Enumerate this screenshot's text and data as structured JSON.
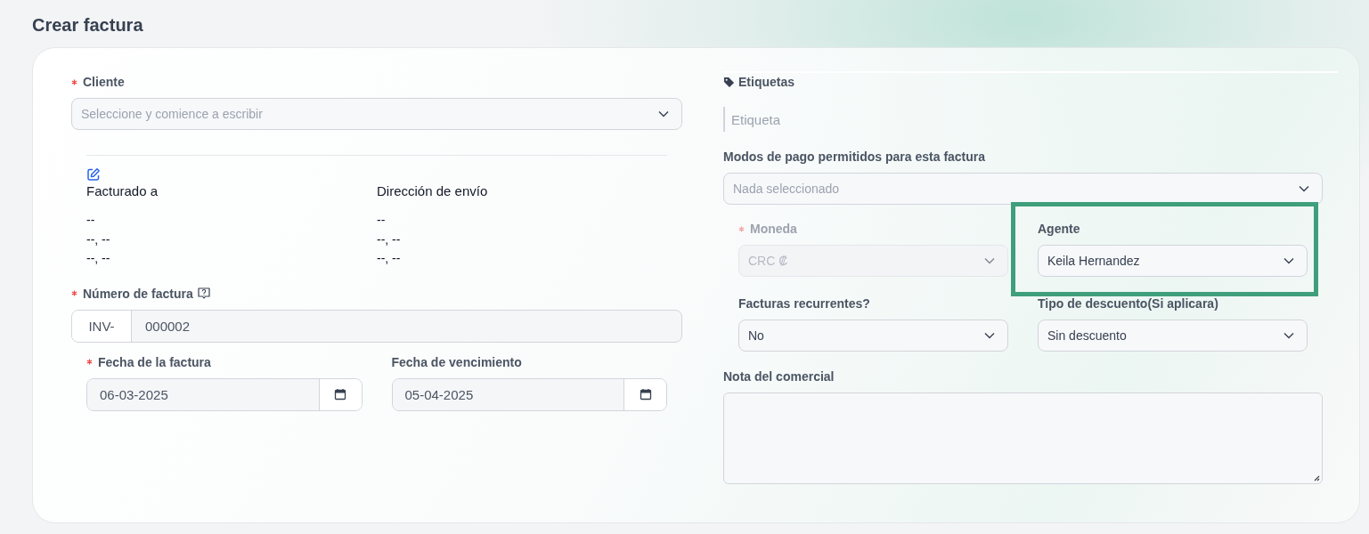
{
  "page": {
    "title": "Crear factura"
  },
  "client": {
    "label": "Cliente",
    "required": true,
    "placeholder": "Seleccione y comience a escribir"
  },
  "addresses": [
    {
      "heading": "Facturado a",
      "lines": [
        "--",
        "--, --",
        "--, --"
      ]
    },
    {
      "heading": "Dirección de envío",
      "lines": [
        "--",
        "--, --",
        "--, --"
      ]
    }
  ],
  "invoice_number": {
    "label": "Número de factura",
    "required": true,
    "prefix": "INV-",
    "value": "000002"
  },
  "dates": [
    {
      "label": "Fecha de la factura",
      "required": true,
      "value": "06-03-2025"
    },
    {
      "label": "Fecha de vencimiento",
      "required": false,
      "value": "05-04-2025"
    }
  ],
  "tags": {
    "label": "Etiquetas",
    "placeholder": "Etiqueta"
  },
  "payment_modes": {
    "label": "Modos de pago permitidos para esta factura",
    "placeholder": "Nada seleccionado"
  },
  "selects": [
    {
      "label": "Moneda",
      "required": true,
      "disabled": true,
      "value": "CRC ₡",
      "highlighted": false
    },
    {
      "label": "Agente",
      "required": false,
      "disabled": false,
      "value": "Keila Hernandez",
      "highlighted": true
    },
    {
      "label": "Facturas recurrentes?",
      "required": false,
      "disabled": false,
      "value": "No",
      "highlighted": false
    },
    {
      "label": "Tipo de descuento(Si aplicara)",
      "required": false,
      "disabled": false,
      "value": "Sin descuento",
      "highlighted": false
    }
  ],
  "note": {
    "label": "Nota del comercial"
  }
}
